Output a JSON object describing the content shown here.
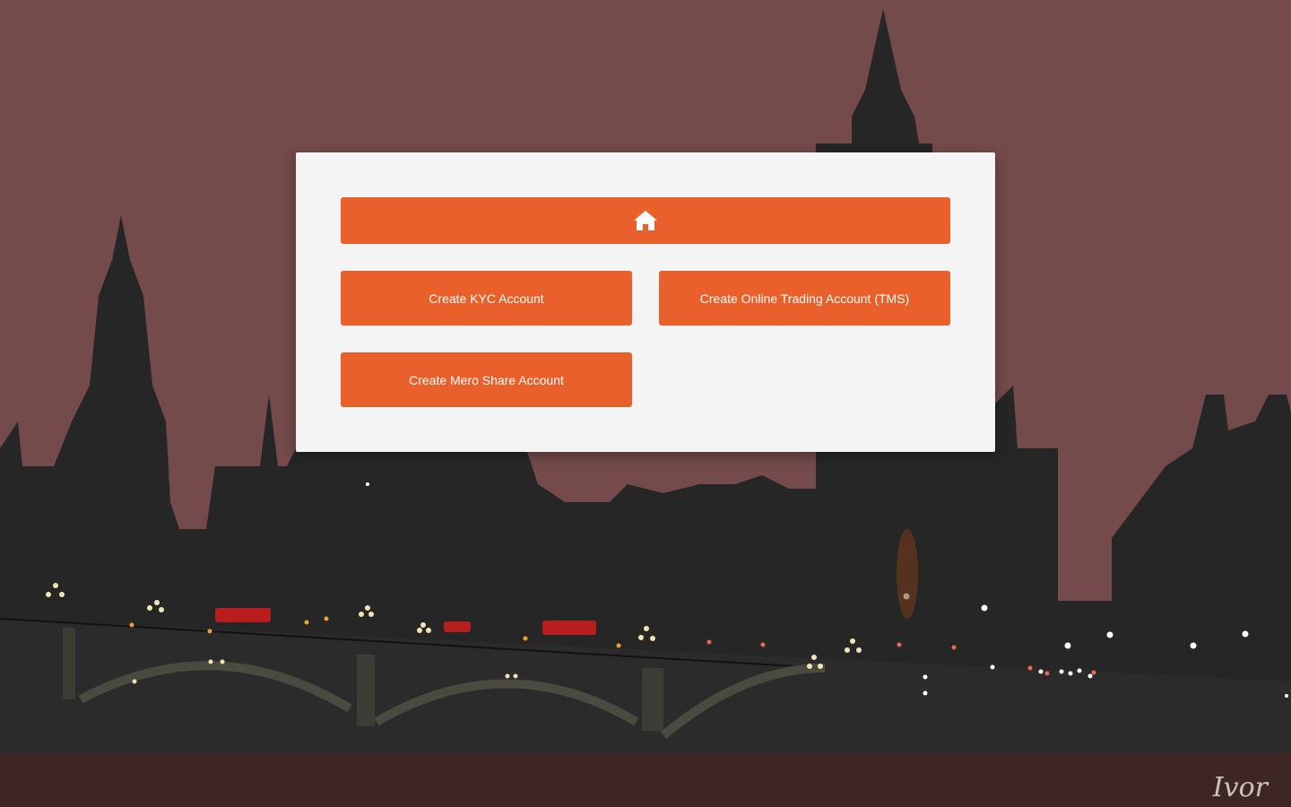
{
  "colors": {
    "sky": "#744a4a",
    "silhouette": "#262626",
    "panel": "#f4f4f4",
    "accent": "#e9602b",
    "button_text": "#ffffff"
  },
  "home_button": {
    "icon": "home-icon"
  },
  "buttons": {
    "kyc_label": "Create KYC Account",
    "tms_label": "Create Online Trading Account (TMS)",
    "mero_share_label": "Create Mero Share Account"
  },
  "background": {
    "scene": "city-skyline-night-illustration",
    "signature_text": "Ivor"
  }
}
